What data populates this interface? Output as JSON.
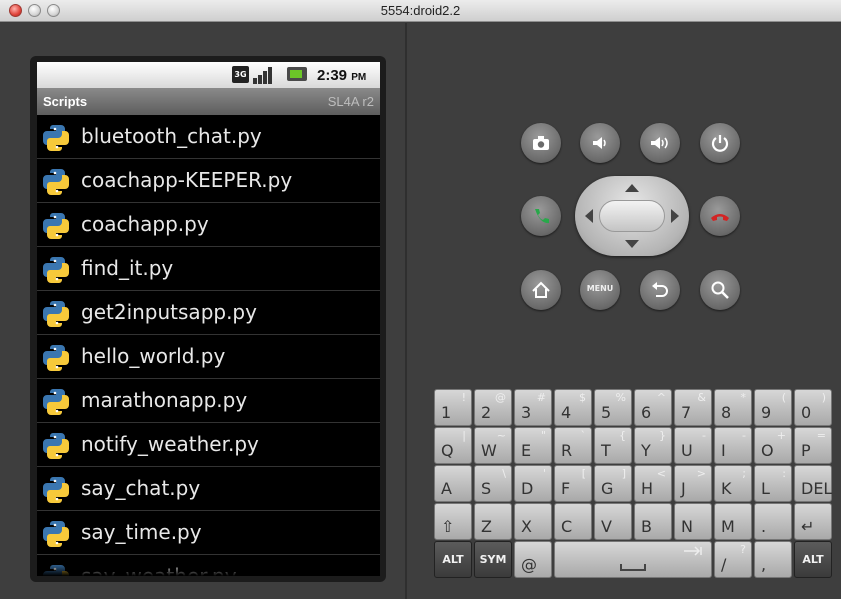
{
  "window": {
    "title": "5554:droid2.2"
  },
  "status_bar": {
    "network": "3G",
    "time": "2:39",
    "ampm": "PM"
  },
  "app": {
    "title": "Scripts",
    "subtitle": "SL4A r2"
  },
  "scripts": [
    {
      "label": "bluetooth_chat.py"
    },
    {
      "label": "coachapp-KEEPER.py"
    },
    {
      "label": "coachapp.py"
    },
    {
      "label": "find_it.py"
    },
    {
      "label": "get2inputsapp.py"
    },
    {
      "label": "hello_world.py"
    },
    {
      "label": "marathonapp.py"
    },
    {
      "label": "notify_weather.py"
    },
    {
      "label": "say_chat.py"
    },
    {
      "label": "say_time.py"
    },
    {
      "label": "say_weather.py"
    }
  ],
  "controls": {
    "menu_label": "MENU"
  },
  "keyboard": {
    "row1": [
      {
        "main": "1",
        "alt": "!"
      },
      {
        "main": "2",
        "alt": "@"
      },
      {
        "main": "3",
        "alt": "#"
      },
      {
        "main": "4",
        "alt": "$"
      },
      {
        "main": "5",
        "alt": "%"
      },
      {
        "main": "6",
        "alt": "^"
      },
      {
        "main": "7",
        "alt": "&"
      },
      {
        "main": "8",
        "alt": "*"
      },
      {
        "main": "9",
        "alt": "("
      },
      {
        "main": "0",
        "alt": ")"
      }
    ],
    "row2": [
      {
        "main": "Q",
        "alt": "|"
      },
      {
        "main": "W",
        "alt": "~"
      },
      {
        "main": "E",
        "alt": "\""
      },
      {
        "main": "R",
        "alt": "`"
      },
      {
        "main": "T",
        "alt": "{"
      },
      {
        "main": "Y",
        "alt": "}"
      },
      {
        "main": "U",
        "alt": "-"
      },
      {
        "main": "I",
        "alt": "-"
      },
      {
        "main": "O",
        "alt": "+"
      },
      {
        "main": "P",
        "alt": "="
      }
    ],
    "row3": [
      {
        "main": "A",
        "alt": ""
      },
      {
        "main": "S",
        "alt": "\\"
      },
      {
        "main": "D",
        "alt": "'"
      },
      {
        "main": "F",
        "alt": "["
      },
      {
        "main": "G",
        "alt": "]"
      },
      {
        "main": "H",
        "alt": "<"
      },
      {
        "main": "J",
        "alt": ">"
      },
      {
        "main": "K",
        "alt": ";"
      },
      {
        "main": "L",
        "alt": ":"
      },
      {
        "main": "DEL",
        "alt": ""
      }
    ],
    "row4": [
      {
        "main": "⇧",
        "alt": ""
      },
      {
        "main": "Z",
        "alt": ""
      },
      {
        "main": "X",
        "alt": ""
      },
      {
        "main": "C",
        "alt": ""
      },
      {
        "main": "V",
        "alt": ""
      },
      {
        "main": "B",
        "alt": ""
      },
      {
        "main": "N",
        "alt": ""
      },
      {
        "main": "M",
        "alt": ""
      },
      {
        "main": ".",
        "alt": ""
      },
      {
        "main": "↵",
        "alt": ""
      }
    ],
    "row5": {
      "alt_left": "ALT",
      "sym": "SYM",
      "at": "@",
      "slash": "/",
      "slash_alt": "?",
      "comma": ",",
      "alt_right": "ALT"
    }
  }
}
